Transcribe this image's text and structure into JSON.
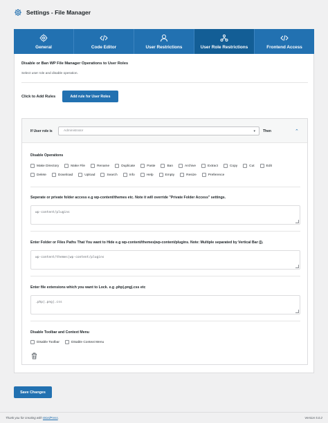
{
  "header": {
    "title": "Settings - File Manager",
    "icon": "gear-icon"
  },
  "tabs": [
    {
      "label": "General",
      "icon": "gear-icon",
      "active": false
    },
    {
      "label": "Code Editor",
      "icon": "code-icon",
      "active": false
    },
    {
      "label": "User Restrictions",
      "icon": "user-icon",
      "active": false
    },
    {
      "label": "User Role Restrictions",
      "icon": "network-icon",
      "active": true
    },
    {
      "label": "Frontend Access",
      "icon": "code-icon",
      "active": false
    }
  ],
  "section": {
    "title": "Disable or Ban WP File Manager Operations to User Roles",
    "description": "Select user role and disable operation.",
    "add_label": "Click to Add Rules",
    "add_button": "Add rule for User Roles"
  },
  "rule": {
    "if_role_label": "If User role is",
    "role_placeholder": "Administrator",
    "then_label": "Then",
    "disable_ops_label": "Disable Operations",
    "operations_row1": [
      "Make Directory",
      "Make File",
      "Rename",
      "Duplicate",
      "Paste",
      "Ban",
      "Archive",
      "Extract",
      "Copy",
      "Cut",
      "Edit"
    ],
    "operations_row2": [
      "Delete",
      "Download",
      "Upload",
      "Search",
      "Info",
      "Help",
      "Empty",
      "Resize",
      "Preference"
    ],
    "folder_access_label": "Seperate or private folder access e.g wp-content/themes etc. Note it will override \"Private Folder Access\" settings.",
    "folder_access_value": "wp-content/plugins",
    "hide_paths_label": "Enter Folder or Files Paths That You want to Hide e.g wp-content/themes|wp-content/plugins. Note: Multiple separated by Vertical Bar (|).",
    "hide_paths_value": "wp-content/themes|wp-content/plugins",
    "lock_ext_label": "Enter file extensions which you want to Lock. e.g .php|.png|.css etc",
    "lock_ext_value": ".php|.png|.css",
    "toolbar_label": "Disable Toolbar and Context Menu",
    "toolbar_options": [
      "Disable Toolbar",
      "Disable Context Menu"
    ]
  },
  "save_button": "Save Changes",
  "footer": {
    "thanks_prefix": "Thank you for creating with ",
    "thanks_link": "WordPress",
    "thanks_suffix": ".",
    "version": "Version 5.0.2"
  },
  "colors": {
    "accent": "#2271b1",
    "active_tab": "#135e96"
  }
}
